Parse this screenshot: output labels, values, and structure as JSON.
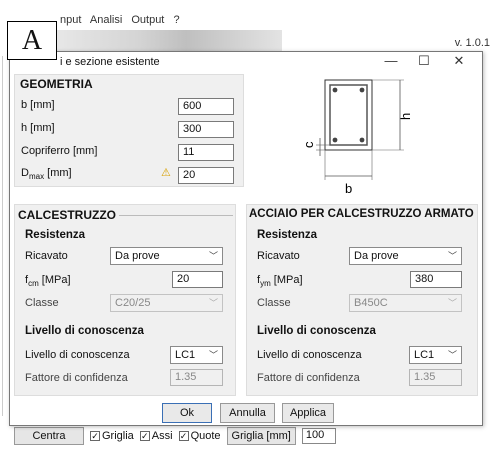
{
  "background_app": {
    "menu_visible": [
      "nput",
      "Analisi",
      "Output",
      "?"
    ],
    "version": "v. 1.0.1",
    "bottom_toolbar": {
      "center_button": "Centra",
      "checks": [
        {
          "label": "Griglia",
          "checked": true
        },
        {
          "label": "Assi",
          "checked": true
        },
        {
          "label": "Quote",
          "checked": true
        }
      ],
      "grid_label": "Griglia [mm]",
      "grid_value": "100"
    }
  },
  "annotation_label": "A",
  "dialog": {
    "title": "i e sezione esistente",
    "controls": {
      "minimize": "—",
      "maximize": "☐",
      "close": "✕"
    },
    "geometria": {
      "title": "GEOMETRIA",
      "fields": [
        {
          "label": "b [mm]",
          "value": "600"
        },
        {
          "label": "h [mm]",
          "value": "300"
        },
        {
          "label": "Copriferro [mm]",
          "value": "11"
        },
        {
          "label_main": "D",
          "label_sub": "max",
          "label_unit": " [mm]",
          "value": "20",
          "warning": true
        }
      ]
    },
    "diagram": {
      "h_label": "h",
      "c_label": "c",
      "b_label": "b"
    },
    "calcestruzzo": {
      "title": "CALCESTRUZZO",
      "resistenza": {
        "title": "Resistenza",
        "ricavato_label": "Ricavato",
        "ricavato_value": "Da prove",
        "strength_label_main": "f",
        "strength_label_sub": "cm",
        "strength_label_unit": " [MPa]",
        "strength_value": "20",
        "classe_label": "Classe",
        "classe_value": "C20/25"
      },
      "livello": {
        "title": "Livello di conoscenza",
        "livello_label": "Livello di conoscenza",
        "livello_value": "LC1",
        "fattore_label": "Fattore di confidenza",
        "fattore_value": "1.35"
      }
    },
    "acciaio": {
      "title": "ACCIAIO PER CALCESTRUZZO ARMATO",
      "resistenza": {
        "title": "Resistenza",
        "ricavato_label": "Ricavato",
        "ricavato_value": "Da prove",
        "strength_label_main": "f",
        "strength_label_sub": "ym",
        "strength_label_unit": " [MPa]",
        "strength_value": "380",
        "classe_label": "Classe",
        "classe_value": "B450C"
      },
      "livello": {
        "title": "Livello di conoscenza",
        "livello_label": "Livello di conoscenza",
        "livello_value": "LC1",
        "fattore_label": "Fattore di confidenza",
        "fattore_value": "1.35"
      }
    },
    "buttons": {
      "ok": "Ok",
      "annulla": "Annulla",
      "applica": "Applica"
    }
  },
  "colors": {
    "panel_bg": "#f0f0f0",
    "warning": "#d8a000",
    "focus_border": "#3a6fb5"
  }
}
